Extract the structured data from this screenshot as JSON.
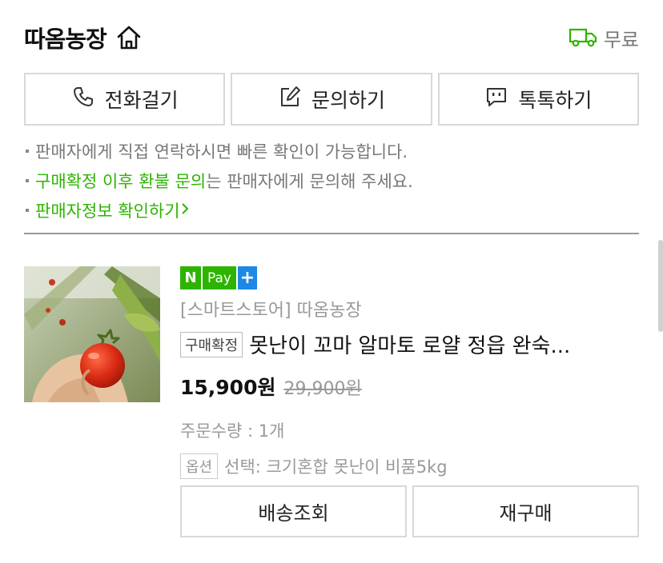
{
  "header": {
    "store_name": "따옴농장",
    "shipping_text": "무료"
  },
  "contact": {
    "call_label": "전화걸기",
    "inquiry_label": "문의하기",
    "talk_label": "톡톡하기"
  },
  "notices": {
    "line1": "판매자에게 직접 연락하시면 빠른 확인이 가능합니다.",
    "line2_highlight": "구매확정 이후 환불 문의",
    "line2_rest": "는 판매자에게 문의해 주세요.",
    "seller_info_link": "판매자정보 확인하기"
  },
  "order": {
    "npay_n": "N",
    "npay_pay": "Pay",
    "npay_plus": "+",
    "store_label": "[스마트스토어] 따옴농장",
    "status_badge": "구매확정",
    "product_title": "못난이 꼬마 알마토 로얄 정읍 완숙...",
    "price": "15,900원",
    "original_price": "29,900원",
    "quantity_text": "주문수량 : 1개",
    "option_badge": "옵션",
    "option_text": "선택: 크기혼합 못난이 비품5kg"
  },
  "actions": {
    "track_label": "배송조회",
    "reorder_label": "재구매"
  },
  "colors": {
    "accent_green": "#2db400",
    "plus_blue": "#1e88e5"
  }
}
